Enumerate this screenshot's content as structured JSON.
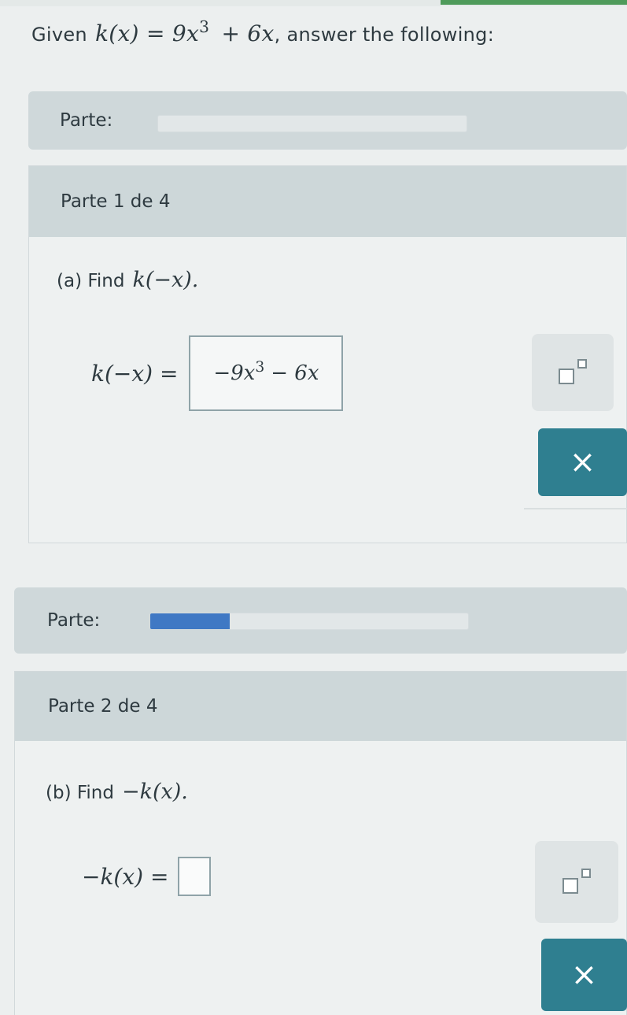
{
  "given": {
    "prefix": "Given",
    "func_lhs": "k(x) = 9x",
    "exp": "3",
    "func_rhs": "+ 6x",
    "suffix": ", answer the following:"
  },
  "parts": [
    {
      "parte_label": "Parte:",
      "progress_fraction": 0.0,
      "title": "Parte 1 de 4",
      "question_prefix": "(a) Find",
      "question_expr": "k(−x).",
      "eq_lhs": "k(−x) =",
      "answer_a": "−9x",
      "answer_exp": "3",
      "answer_b": "− 6x",
      "template_button": "exponent-template",
      "clear_button": "×"
    },
    {
      "parte_label": "Parte:",
      "progress_fraction": 0.25,
      "title": "Parte 2 de 4",
      "question_prefix": "(b) Find",
      "question_expr": "−k(x).",
      "eq_lhs": "−k(x) =",
      "answer_value": "",
      "template_button": "exponent-template",
      "clear_button": "×"
    }
  ],
  "colors": {
    "accent": "#2f7f90",
    "progress": "#3f78c4",
    "header": "#cdd7d9"
  }
}
